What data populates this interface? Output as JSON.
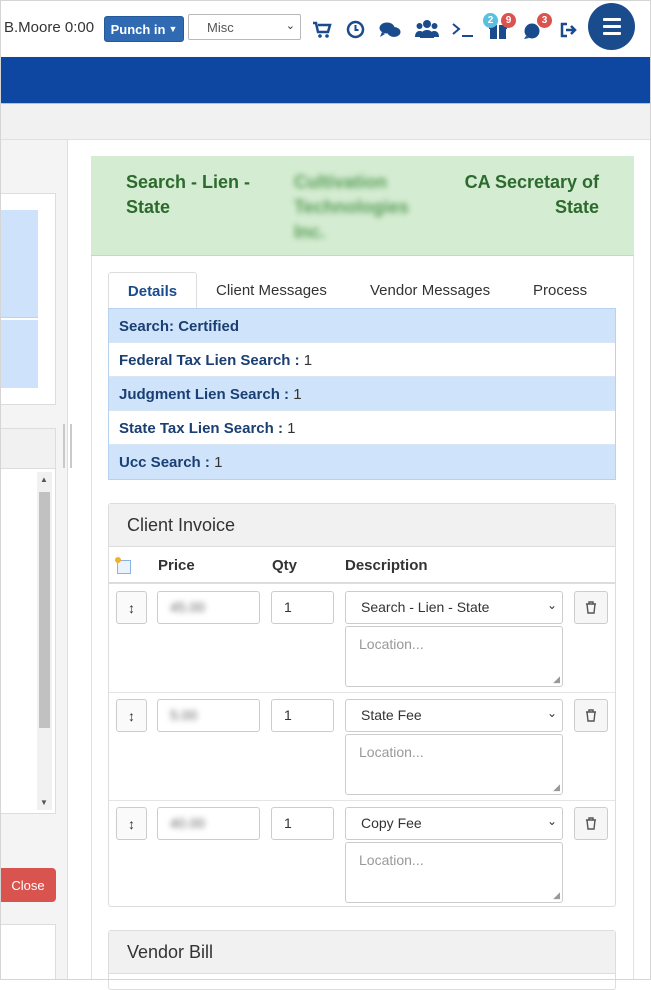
{
  "topbar": {
    "user": "B.Moore 0:00",
    "punch_label": "Punch in",
    "misc_value": "Misc",
    "badges": {
      "alerts": "2",
      "tasks": "9",
      "messages": "3"
    },
    "icons": [
      "cart-icon",
      "clock-icon",
      "chat-icon",
      "users-icon",
      "terminal-icon",
      "notification-icon",
      "bubble-icon",
      "logout-icon",
      "menu-icon"
    ],
    "accent": "#0d47a1"
  },
  "left": {
    "close_label": "Close"
  },
  "order": {
    "title": "Search - Lien - State",
    "company": "Cultivation Technologies Inc.",
    "agency": "CA Secretary of State",
    "header_color": "#d4ecd1"
  },
  "tabs": [
    "Details",
    "Client Messages",
    "Vendor Messages",
    "Process"
  ],
  "details": [
    {
      "key": "Search: Certified",
      "value": ""
    },
    {
      "key": "Federal Tax Lien Search :",
      "value": "1"
    },
    {
      "key": "Judgment Lien Search :",
      "value": "1"
    },
    {
      "key": "State Tax Lien Search :",
      "value": "1"
    },
    {
      "key": "Ucc Search :",
      "value": "1"
    }
  ],
  "invoice": {
    "title": "Client Invoice",
    "columns": [
      "Price",
      "Qty",
      "Description"
    ],
    "location_placeholder": "Location...",
    "lines": [
      {
        "price": "45.00",
        "qty": "1",
        "description": "Search - Lien - State"
      },
      {
        "price": "5.00",
        "qty": "1",
        "description": "State Fee"
      },
      {
        "price": "40.00",
        "qty": "1",
        "description": "Copy Fee"
      }
    ]
  },
  "vendor": {
    "title": "Vendor Bill"
  }
}
